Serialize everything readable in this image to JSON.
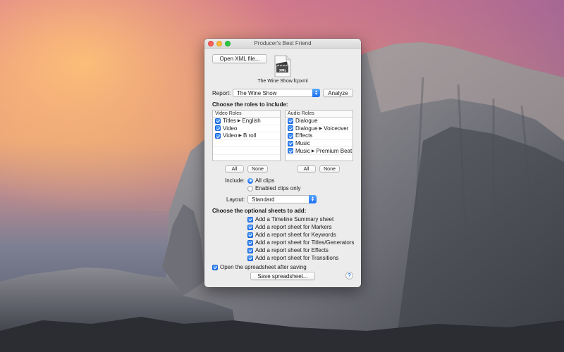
{
  "window": {
    "title": "Producer's Best Friend",
    "open_button": "Open XML file...",
    "file_icon_label": "XML",
    "file_name": "The Wine Show.fcpxml",
    "report_label": "Report:",
    "report_value": "The Wine Show",
    "analyze_button": "Analyze",
    "roles_heading": "Choose the roles to include:",
    "video_roles": {
      "header": "Video Roles",
      "items": [
        {
          "parts": [
            "Titles",
            "English"
          ],
          "checked": true
        },
        {
          "parts": [
            "Video"
          ],
          "checked": true
        },
        {
          "parts": [
            "Video",
            "B roll"
          ],
          "checked": true
        }
      ],
      "all_button": "All",
      "none_button": "None"
    },
    "audio_roles": {
      "header": "Audio Roles",
      "items": [
        {
          "parts": [
            "Dialogue"
          ],
          "checked": true
        },
        {
          "parts": [
            "Dialogue",
            "Voiceover"
          ],
          "checked": true
        },
        {
          "parts": [
            "Effects"
          ],
          "checked": true
        },
        {
          "parts": [
            "Music"
          ],
          "checked": true
        },
        {
          "parts": [
            "Music",
            "Premium Beat"
          ],
          "checked": true
        }
      ],
      "all_button": "All",
      "none_button": "None"
    },
    "include_label": "Include:",
    "include_options": [
      {
        "label": "All clips",
        "selected": true
      },
      {
        "label": "Enabled clips only",
        "selected": false
      }
    ],
    "layout_label": "Layout:",
    "layout_value": "Standard",
    "sheets_heading": "Choose the optional sheets to add:",
    "sheets": [
      {
        "label": "Add a Timeline Summary sheet",
        "checked": true
      },
      {
        "label": "Add a report sheet for Markers",
        "checked": true
      },
      {
        "label": "Add a report sheet for Keywords",
        "checked": true
      },
      {
        "label": "Add a report sheet for Titles/Generators",
        "checked": true
      },
      {
        "label": "Add a report sheet for Effects",
        "checked": true
      },
      {
        "label": "Add a report sheet for Transitions",
        "checked": true
      }
    ],
    "open_after_saving": {
      "label": "Open the spreadsheet after saving",
      "checked": true
    },
    "save_button": "Save spreadsheet...",
    "help_glyph": "?"
  },
  "colors": {
    "accent": "#1d6ff2",
    "close": "#fc5f57",
    "minimize": "#fdbc2e",
    "maximize": "#29c840"
  }
}
